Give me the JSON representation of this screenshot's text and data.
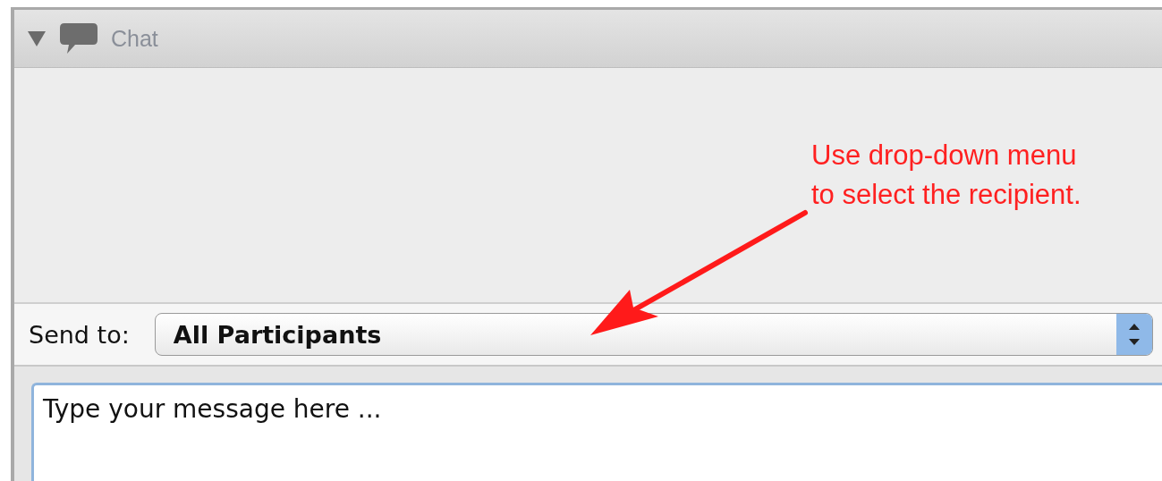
{
  "panel": {
    "title": "Chat",
    "expanded": true
  },
  "send_to": {
    "label": "Send to:",
    "value": "All Participants"
  },
  "message": {
    "value": "Type your message here ..."
  },
  "annotation": {
    "text": "Use drop-down menu\nto select the recipient."
  }
}
